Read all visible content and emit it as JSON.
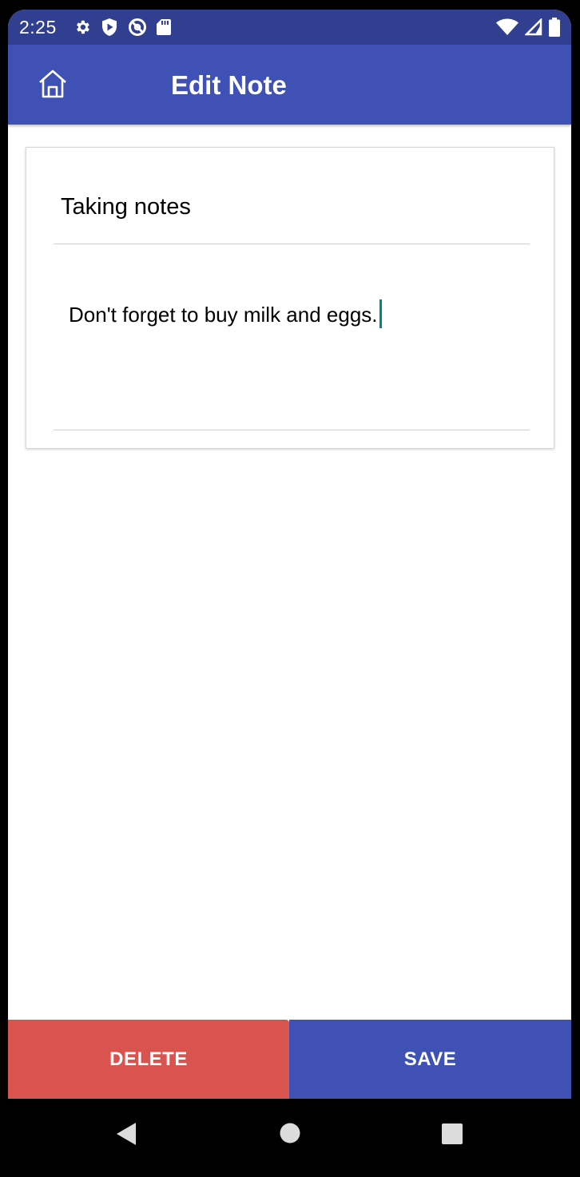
{
  "status_bar": {
    "time": "2:25",
    "icons_left": [
      "settings-icon",
      "play-protect-icon",
      "no-location-icon",
      "sd-card-icon"
    ],
    "icons_right": [
      "wifi-icon",
      "signal-icon",
      "battery-icon"
    ]
  },
  "app_bar": {
    "title": "Edit Note",
    "home_icon": "home-icon"
  },
  "note": {
    "title": "Taking notes",
    "body": "Don't forget to buy milk and eggs."
  },
  "actions": {
    "delete_label": "DELETE",
    "save_label": "SAVE"
  },
  "nav_bar": {
    "icons": [
      "back-icon",
      "home-circle-icon",
      "recents-icon"
    ]
  },
  "colors": {
    "status_bar": "#303f8f",
    "primary": "#3f51b5",
    "delete": "#d9534f",
    "cursor": "#00897b"
  }
}
